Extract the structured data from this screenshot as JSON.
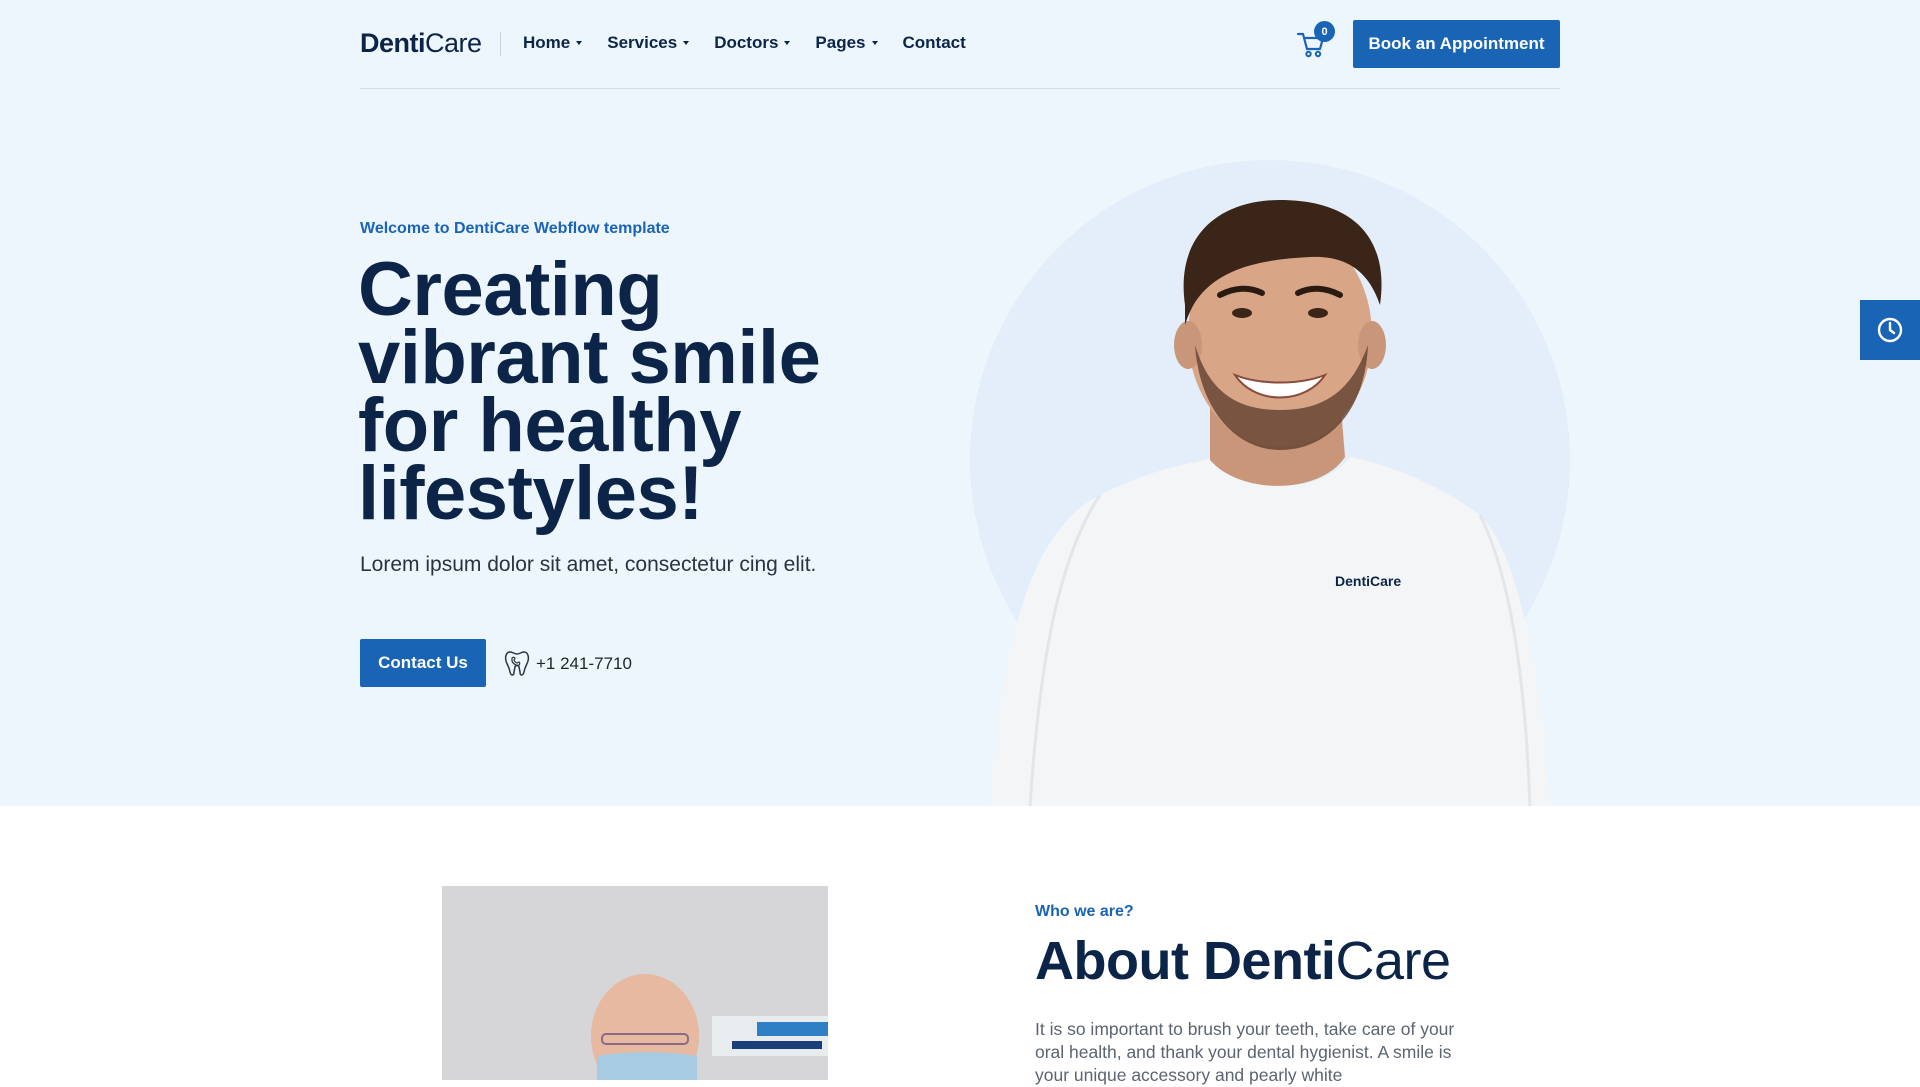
{
  "header": {
    "logo_bold": "Denti",
    "logo_light": "Care",
    "nav": [
      {
        "label": "Home",
        "has_dropdown": true
      },
      {
        "label": "Services",
        "has_dropdown": true
      },
      {
        "label": "Doctors",
        "has_dropdown": true
      },
      {
        "label": "Pages",
        "has_dropdown": true
      },
      {
        "label": "Contact",
        "has_dropdown": false
      }
    ],
    "cart_count": "0",
    "cta_label": "Book an Appointment"
  },
  "hero": {
    "eyebrow": "Welcome to DentiCare Webflow template",
    "title_lines": [
      "Creating",
      "vibrant smile",
      "for healthy",
      "lifestyles!"
    ],
    "subtitle": "Lorem ipsum dolor sit amet, consectetur cing elit.",
    "contact_label": "Contact Us",
    "phone": "+1 241-7710",
    "shirt_logo": "DentiCare"
  },
  "about": {
    "eyebrow": "Who we are?",
    "title_bold": "About Denti",
    "title_light": "Care",
    "text": "It is so important to brush your teeth, take care of your oral health, and thank your dental hygienist. A smile is your unique accessory and pearly white"
  },
  "icons": {
    "cart": "cart-icon",
    "phone": "tooth-phone-icon",
    "side_widget": "clock-icon"
  },
  "colors": {
    "primary": "#1a64b5",
    "navy": "#0b2447",
    "hero_bg": "#eef6fd"
  }
}
